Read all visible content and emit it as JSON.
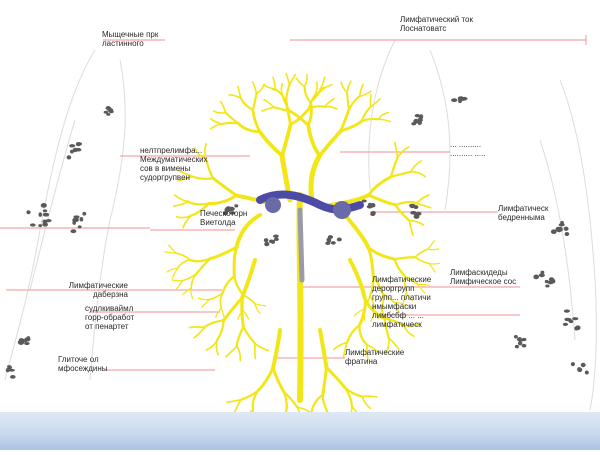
{
  "labels": {
    "top_left": "Мыщечные прк\nластинного",
    "top_right": "Лимфатический ток\nЛоснатоватс",
    "upper_right": "... ..........\n.......... .....",
    "mid_left_1": "нелтпрелимфа... \nМеждуматических\nсов в вимены\nсудоргрупвен",
    "center": "Печескоторн\nВиетолда",
    "right_1": "Лимфатическ\nбедренныма",
    "right_2": "Лимфаскидеды\nЛимфическое сос",
    "mid_right": "Лимфатические\nдероргрупп\nгрупп... платичи\nнмымфаски\nлимбсбф  ... ...\nлимфатическ",
    "left_2": "Лимфатические\nдаберзна",
    "left_3": "судлкиваймл\nгорр-обработ\nот пенартет",
    "left_4": "Глиточе ол\nмфосеждины",
    "bottom_center": "Лимфатические\nфратина"
  },
  "colors": {
    "vessels": "#f2e618",
    "nodes": "#5a5a5a",
    "leader_lines": "#f3a6a6",
    "veins": "#4c4ca6",
    "floor": "#c7d8ec"
  }
}
